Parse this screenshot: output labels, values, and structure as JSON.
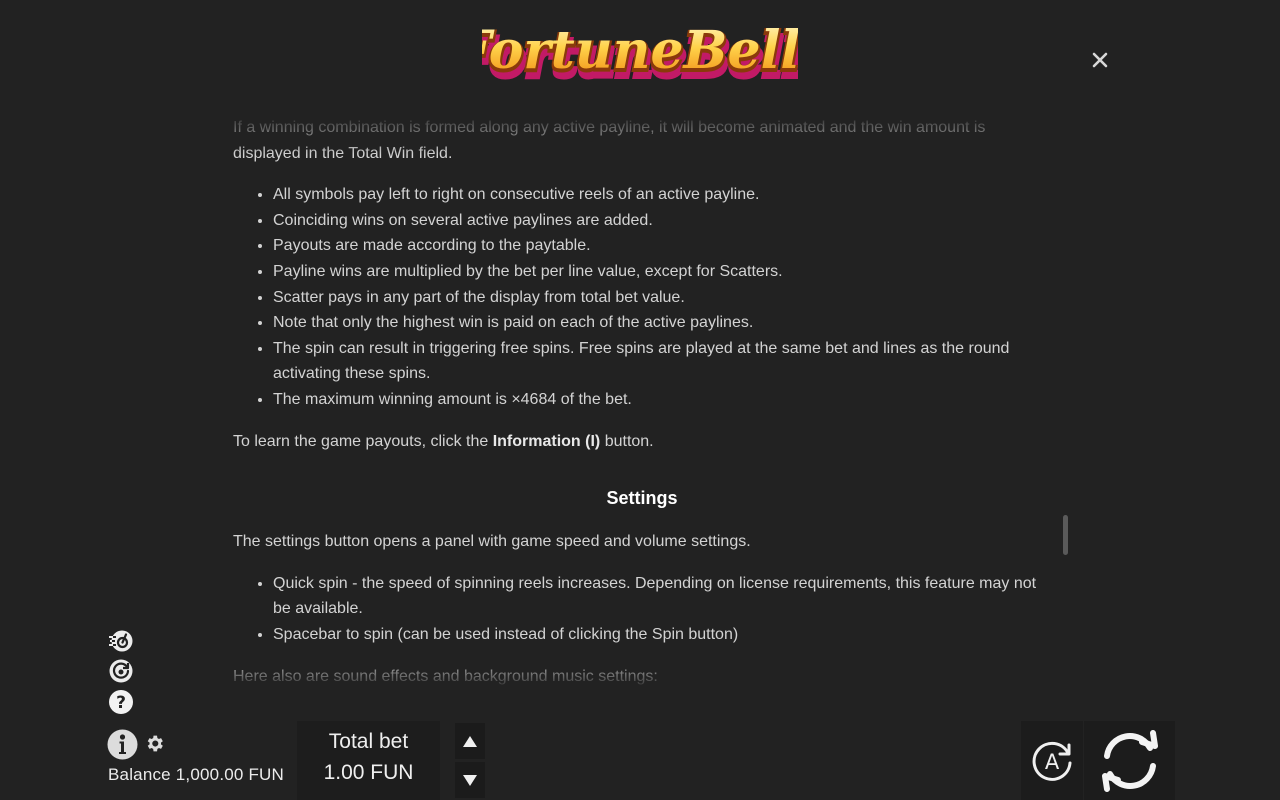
{
  "logo": {
    "text": "FortuneBells"
  },
  "rules": {
    "intro": "If a winning combination is formed along any active payline, it will become animated and the win amount is displayed in the Total Win field.",
    "win_rules": [
      "All symbols pay left to right on consecutive reels of an active payline.",
      "Coinciding wins on several active paylines are added.",
      "Payouts are made according to the paytable.",
      "Payline wins are multiplied by the bet per line value, except for Scatters.",
      "Scatter pays in any part of the display from total bet value.",
      "Note that only the highest win is paid on each of the active paylines.",
      "The spin can result in triggering free spins. Free spins are played at the same bet and lines as the round activating these spins.",
      "The maximum winning amount is ×4684 of the bet."
    ],
    "learn_prefix": "To learn the game payouts, click the ",
    "learn_bold": "Information (I)",
    "learn_suffix": " button.",
    "settings_heading": "Settings",
    "settings_intro": "The settings button opens a panel with game speed and volume settings.",
    "settings_items": [
      "Quick spin - the speed of spinning reels increases. Depending on license requirements, this feature may not be available.",
      "Spacebar to spin (can be used instead of clicking the Spin button)"
    ],
    "sound_intro": "Here also are sound effects and background music settings:"
  },
  "footer": {
    "balance_label": "Balance",
    "balance_value": "1,000.00 FUN",
    "total_bet_label": "Total bet",
    "total_bet_value": "1.00 FUN",
    "auto_letter": "A"
  },
  "icons": {
    "close": "close-icon",
    "side": [
      "fast-spin-icon",
      "autoplay-icon",
      "help-icon",
      "info-icon",
      "gear-icon"
    ],
    "bet_up": "arrow-up-icon",
    "bet_down": "arrow-down-icon",
    "autoplay": "autoplay-a-icon",
    "spin": "spin-icon"
  },
  "colors": {
    "background": "#222222",
    "text": "#d3d3d3",
    "heading": "#ffffff",
    "logo_gold": "#f7c84a",
    "logo_pink": "#e0287e"
  }
}
